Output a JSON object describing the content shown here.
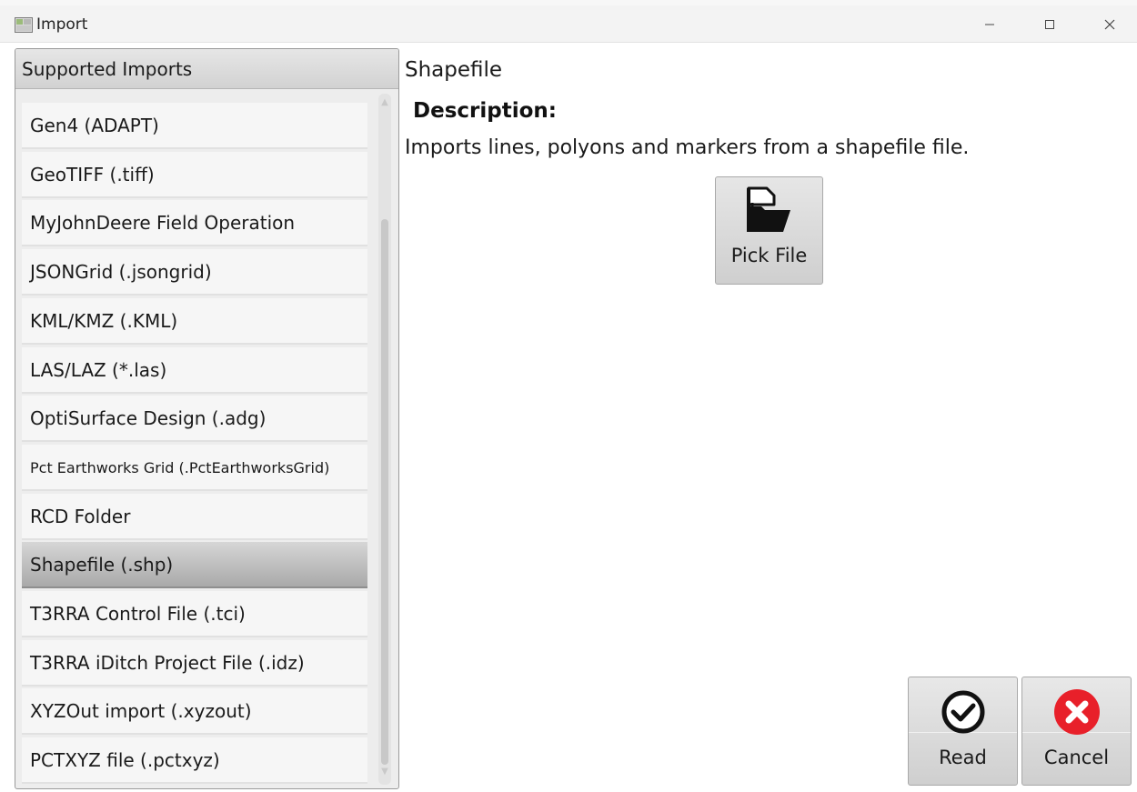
{
  "window": {
    "title": "Import",
    "icons": [
      "app-icon",
      "minimize-icon",
      "maximize-icon",
      "close-icon"
    ]
  },
  "sidebar": {
    "header": "Supported Imports",
    "selected_index": 9,
    "items": [
      {
        "label": "Gen4 (ADAPT)"
      },
      {
        "label": "GeoTIFF (.tiff)"
      },
      {
        "label": "MyJohnDeere Field Operation"
      },
      {
        "label": "JSONGrid (.jsongrid)"
      },
      {
        "label": "KML/KMZ (.KML)"
      },
      {
        "label": "LAS/LAZ (*.las)"
      },
      {
        "label": "OptiSurface Design (.adg)"
      },
      {
        "label": "Pct Earthworks Grid (.PctEarthworksGrid)"
      },
      {
        "label": "RCD Folder"
      },
      {
        "label": "Shapefile (.shp)"
      },
      {
        "label": "T3RRA Control File (.tci)"
      },
      {
        "label": "T3RRA iDitch Project File (.idz)"
      },
      {
        "label": "XYZOut import (.xyzout)"
      },
      {
        "label": "PCTXYZ file (.pctxyz)"
      }
    ]
  },
  "detail": {
    "title": "Shapefile",
    "description_label": "Description:",
    "description": "Imports lines, polyons and markers from a shapefile file.",
    "pick_file_label": "Pick File",
    "pick_file_icon": "open-folder-icon"
  },
  "actions": {
    "read_label": "Read",
    "read_icon": "check-circle-icon",
    "cancel_label": "Cancel",
    "cancel_icon": "red-x-circle-icon"
  },
  "colors": {
    "cancel_red": "#e8202a",
    "selected_item": "#b0b0b0"
  }
}
